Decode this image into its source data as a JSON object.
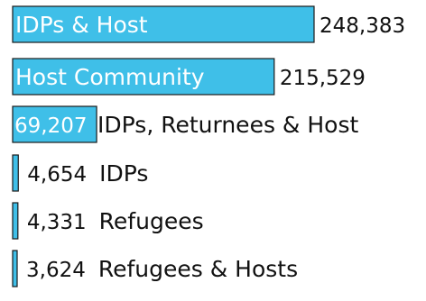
{
  "chart_data": {
    "type": "bar",
    "orientation": "horizontal",
    "categories": [
      "IDPs & Host",
      "Host Community",
      "IDPs, Returnees & Host",
      "IDPs",
      "Refugees",
      "Refugees & Hosts"
    ],
    "values": [
      248383,
      215529,
      69207,
      4654,
      4331,
      3624
    ],
    "value_labels": [
      "248,383",
      "215,529",
      "69,207",
      "4,654",
      "4,331",
      "3,624"
    ],
    "title": "",
    "xlabel": "",
    "ylabel": "",
    "xlim": [
      0,
      248383
    ],
    "grid": false,
    "legend": "none",
    "colors": {
      "bar": "#3fbfe8",
      "bar_outline": "#1a1a1a",
      "text": "#111111",
      "text_on_bar": "#ffffff"
    }
  }
}
